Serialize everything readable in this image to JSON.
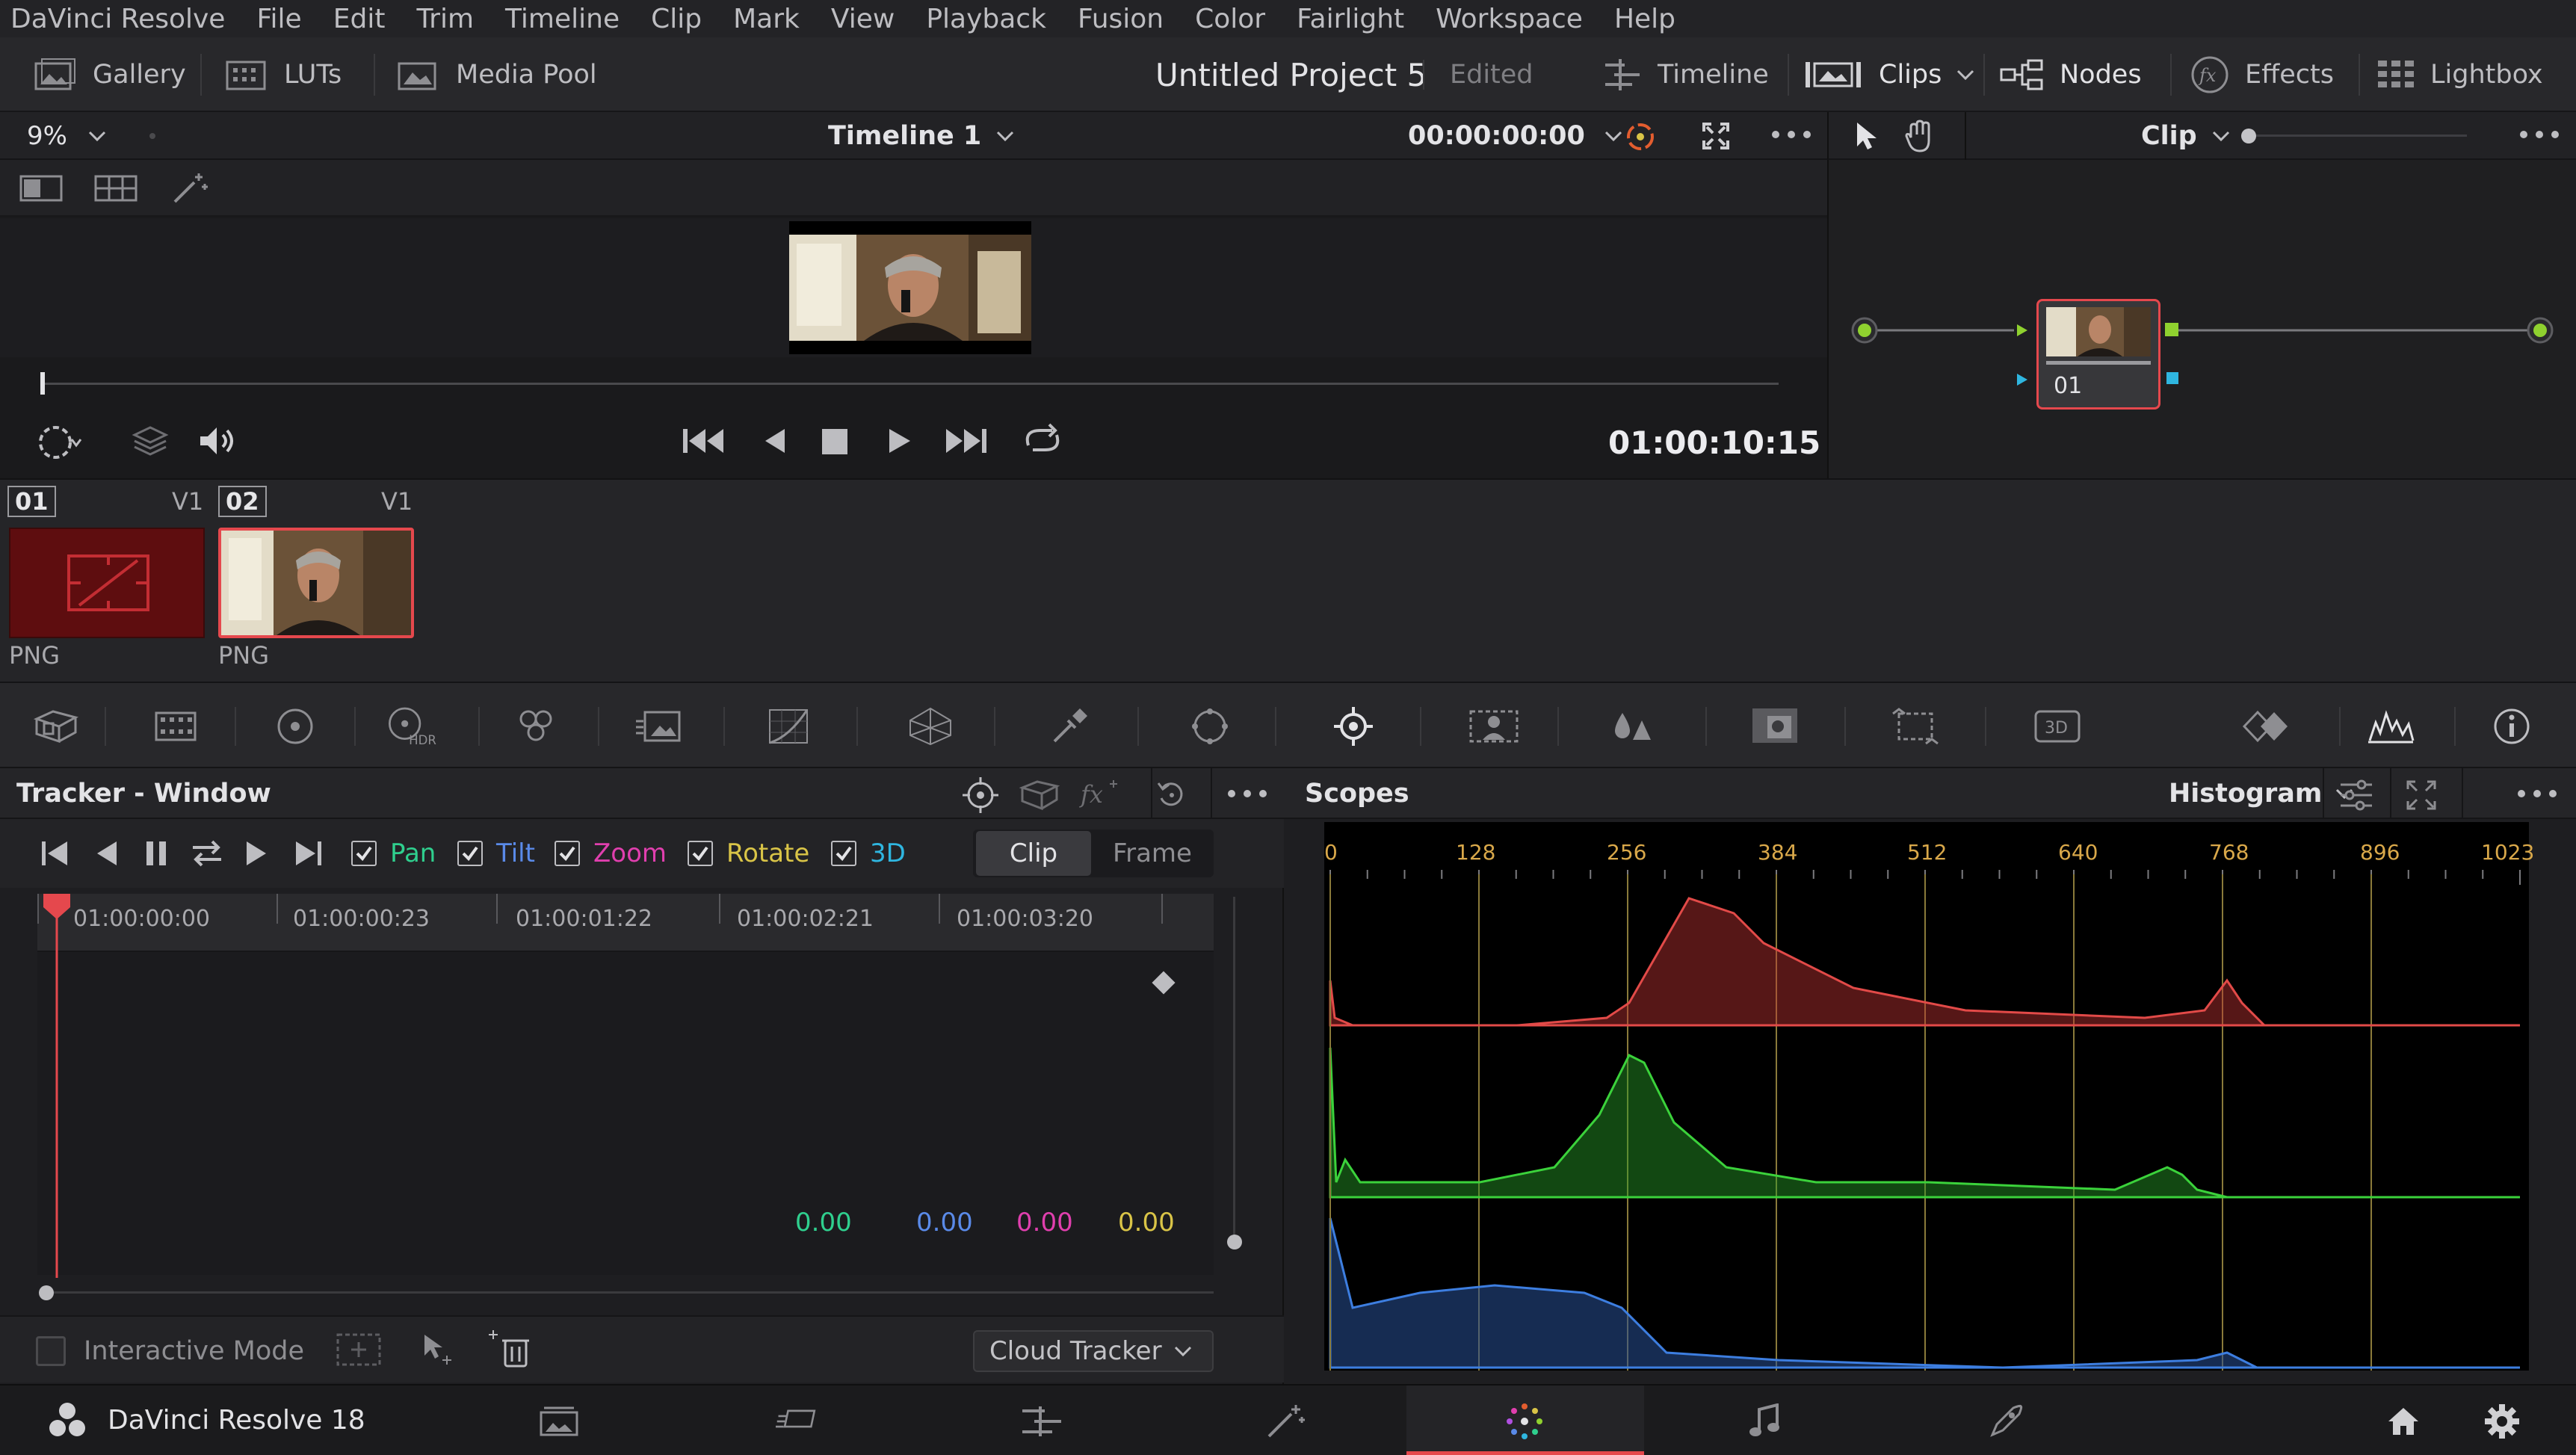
{
  "menu": [
    "DaVinci Resolve",
    "File",
    "Edit",
    "Trim",
    "Timeline",
    "Clip",
    "Mark",
    "View",
    "Playback",
    "Fusion",
    "Color",
    "Fairlight",
    "Workspace",
    "Help"
  ],
  "toolbar": {
    "gallery": "Gallery",
    "luts": "LUTs",
    "media_pool": "Media Pool",
    "project_title": "Untitled Project 5",
    "project_status": "Edited",
    "timeline": "Timeline",
    "clips": "Clips",
    "nodes": "Nodes",
    "effects": "Effects",
    "lightbox": "Lightbox"
  },
  "viewer": {
    "zoom": "9%",
    "timeline_name": "Timeline 1",
    "timecode_top": "00:00:00:00",
    "timecode_current": "01:00:10:15"
  },
  "nodes": {
    "mode": "Clip",
    "node_label": "01"
  },
  "clips": [
    {
      "num": "01",
      "track": "V1",
      "type": "PNG"
    },
    {
      "num": "02",
      "track": "V1",
      "type": "PNG"
    }
  ],
  "tracker": {
    "title": "Tracker - Window",
    "options": {
      "pan": "Pan",
      "tilt": "Tilt",
      "zoom": "Zoom",
      "rotate": "Rotate",
      "three_d": "3D"
    },
    "clip_tab": "Clip",
    "frame_tab": "Frame",
    "ruler": [
      "01:00:00:00",
      "01:00:00:23",
      "01:00:01:22",
      "01:00:02:21",
      "01:00:03:20"
    ],
    "values": {
      "pan": "0.00",
      "tilt": "0.00",
      "zoom": "0.00",
      "rotate": "0.00"
    },
    "interactive_mode": "Interactive Mode",
    "cloud_tracker": "Cloud Tracker"
  },
  "scopes": {
    "title": "Scopes",
    "mode": "Histogram",
    "axis": [
      "0",
      "128",
      "256",
      "384",
      "512",
      "640",
      "768",
      "896",
      "1023"
    ]
  },
  "colors": {
    "pan": "#2fcf8e",
    "tilt": "#5a8ae8",
    "zoom": "#e03fae",
    "rotate": "#d9c447",
    "three_d": "#2fb6e0",
    "accent_red": "#e5484d"
  },
  "app": {
    "name": "DaVinci Resolve 18"
  }
}
